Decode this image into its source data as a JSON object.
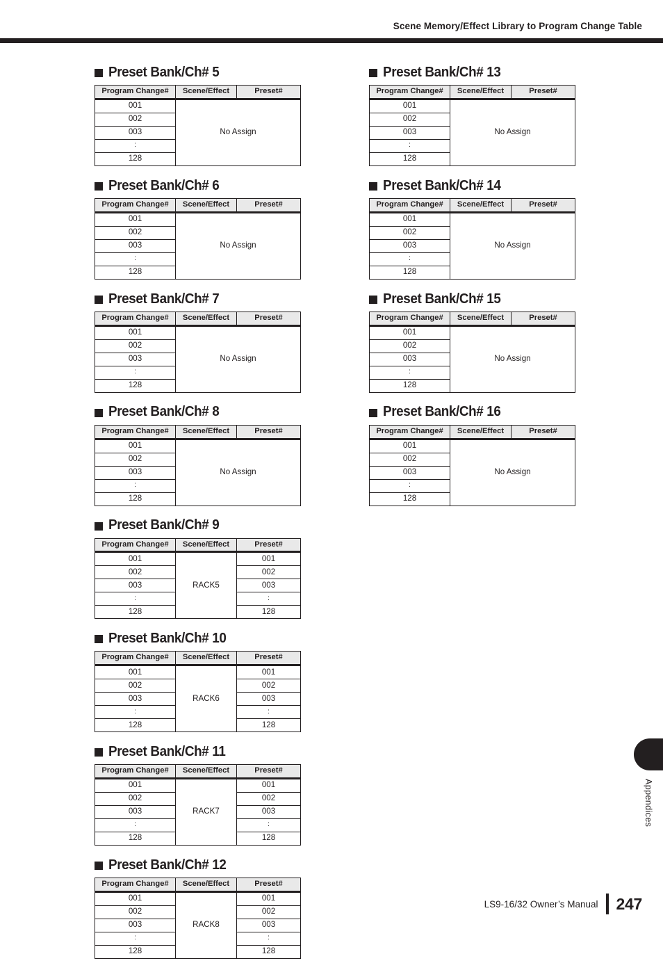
{
  "page": {
    "running_head": "Scene Memory/Effect Library to Program Change Table",
    "side_tab_label": "Appendices",
    "footer_manual": "LS9-16/32  Owner’s Manual",
    "footer_page_number": "247",
    "accent_color": "#231f20",
    "header_row_bg": "#e9e9e9"
  },
  "table_headers": {
    "program_change": "Program Change#",
    "scene_effect": "Scene/Effect",
    "preset": "Preset#"
  },
  "left_column": [
    {
      "title": "Preset Bank/Ch# 5",
      "bullet_icon": "filled-square-icon",
      "program_change_rows": [
        "001",
        "002",
        "003",
        ":",
        "128"
      ],
      "scene_effect_merged": "No Assign",
      "merged_span": 2,
      "preset_rows": []
    },
    {
      "title": "Preset Bank/Ch# 6",
      "bullet_icon": "filled-square-icon",
      "program_change_rows": [
        "001",
        "002",
        "003",
        ":",
        "128"
      ],
      "scene_effect_merged": "No Assign",
      "merged_span": 2,
      "preset_rows": []
    },
    {
      "title": "Preset Bank/Ch# 7",
      "bullet_icon": "filled-square-icon",
      "program_change_rows": [
        "001",
        "002",
        "003",
        ":",
        "128"
      ],
      "scene_effect_merged": "No Assign",
      "merged_span": 2,
      "preset_rows": []
    },
    {
      "title": "Preset Bank/Ch# 8",
      "bullet_icon": "filled-square-icon",
      "program_change_rows": [
        "001",
        "002",
        "003",
        ":",
        "128"
      ],
      "scene_effect_merged": "No Assign",
      "merged_span": 2,
      "preset_rows": []
    },
    {
      "title": "Preset Bank/Ch# 9",
      "bullet_icon": "filled-square-icon",
      "program_change_rows": [
        "001",
        "002",
        "003",
        ":",
        "128"
      ],
      "scene_effect_merged": "RACK5",
      "merged_span": 1,
      "preset_rows": [
        "001",
        "002",
        "003",
        ":",
        "128"
      ]
    },
    {
      "title": "Preset Bank/Ch# 10",
      "bullet_icon": "filled-square-icon",
      "program_change_rows": [
        "001",
        "002",
        "003",
        ":",
        "128"
      ],
      "scene_effect_merged": "RACK6",
      "merged_span": 1,
      "preset_rows": [
        "001",
        "002",
        "003",
        ":",
        "128"
      ]
    },
    {
      "title": "Preset Bank/Ch# 11",
      "bullet_icon": "filled-square-icon",
      "program_change_rows": [
        "001",
        "002",
        "003",
        ":",
        "128"
      ],
      "scene_effect_merged": "RACK7",
      "merged_span": 1,
      "preset_rows": [
        "001",
        "002",
        "003",
        ":",
        "128"
      ]
    },
    {
      "title": "Preset Bank/Ch# 12",
      "bullet_icon": "filled-square-icon",
      "program_change_rows": [
        "001",
        "002",
        "003",
        ":",
        "128"
      ],
      "scene_effect_merged": "RACK8",
      "merged_span": 1,
      "preset_rows": [
        "001",
        "002",
        "003",
        ":",
        "128"
      ]
    }
  ],
  "right_column": [
    {
      "title": "Preset Bank/Ch# 13",
      "bullet_icon": "filled-square-icon",
      "program_change_rows": [
        "001",
        "002",
        "003",
        ":",
        "128"
      ],
      "scene_effect_merged": "No Assign",
      "merged_span": 2,
      "preset_rows": []
    },
    {
      "title": "Preset Bank/Ch# 14",
      "bullet_icon": "filled-square-icon",
      "program_change_rows": [
        "001",
        "002",
        "003",
        ":",
        "128"
      ],
      "scene_effect_merged": "No Assign",
      "merged_span": 2,
      "preset_rows": []
    },
    {
      "title": "Preset Bank/Ch# 15",
      "bullet_icon": "filled-square-icon",
      "program_change_rows": [
        "001",
        "002",
        "003",
        ":",
        "128"
      ],
      "scene_effect_merged": "No Assign",
      "merged_span": 2,
      "preset_rows": []
    },
    {
      "title": "Preset Bank/Ch# 16",
      "bullet_icon": "filled-square-icon",
      "program_change_rows": [
        "001",
        "002",
        "003",
        ":",
        "128"
      ],
      "scene_effect_merged": "No Assign",
      "merged_span": 2,
      "preset_rows": []
    }
  ]
}
